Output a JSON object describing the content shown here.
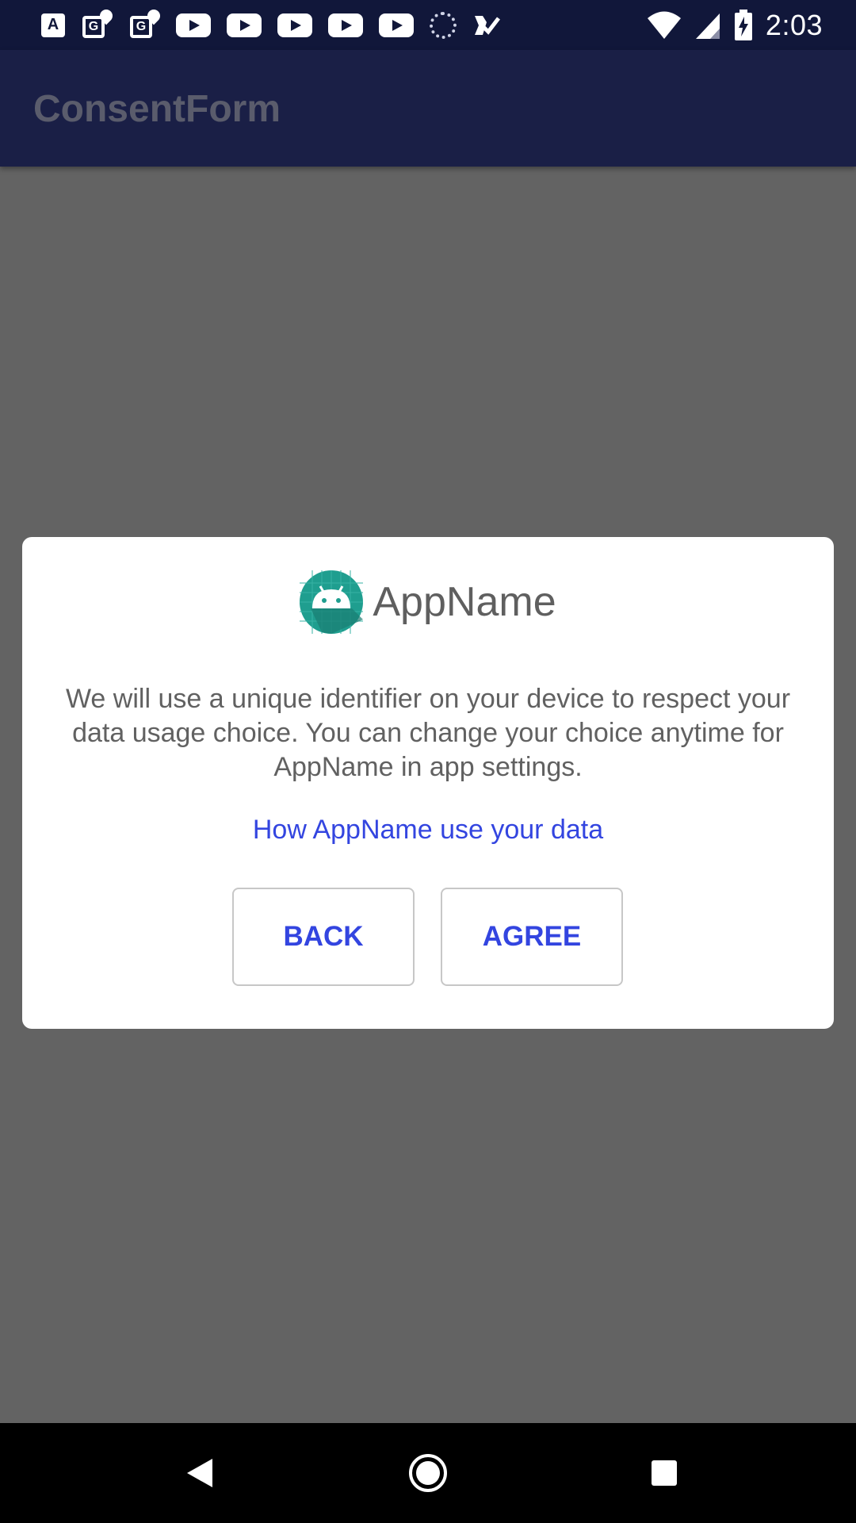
{
  "status_bar": {
    "time": "2:03",
    "notification_icons": [
      "a-translate-icon",
      "maps-pin-icon",
      "maps-pin-icon",
      "youtube-icon",
      "youtube-icon",
      "youtube-icon",
      "youtube-icon",
      "youtube-icon",
      "loading-icon",
      "tasks-icon"
    ],
    "system_icons": [
      "wifi-icon",
      "signal-icon",
      "battery-charging-icon"
    ]
  },
  "app_bar": {
    "title": "ConsentForm"
  },
  "dialog": {
    "app_name": "AppName",
    "message": "We will use a unique identifier on your device to respect your data usage choice. You can change your choice anytime for AppName in app settings.",
    "link_text": "How AppName use your data",
    "back_label": "BACK",
    "agree_label": "AGREE"
  },
  "colors": {
    "status_bar": "#11173a",
    "app_bar": "#1a1f46",
    "scrim": "#636363",
    "accent": "#3345e0"
  }
}
